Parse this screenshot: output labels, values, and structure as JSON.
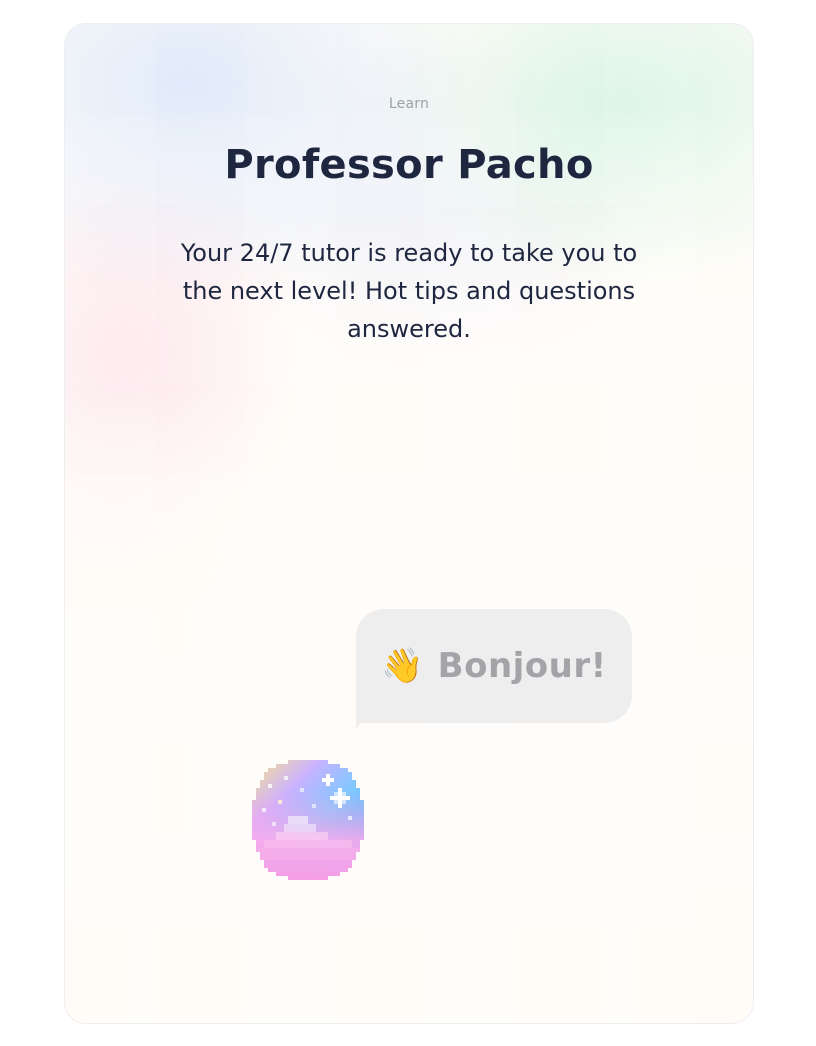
{
  "header": {
    "eyebrow": "Learn",
    "title": "Professor Pacho",
    "description": "Your 24/7 tutor is ready to take you to the next level! Hot tips and questions answered."
  },
  "chat": {
    "greeting_emoji": "👋",
    "greeting_text": "Bonjour!"
  },
  "avatar": {
    "icon": "pixel-orb-avatar"
  },
  "colors": {
    "title": "#1e2640",
    "eyebrow": "#9aa1a8",
    "bubble_bg": "#eeeeee",
    "bubble_text": "#a3a3a8"
  }
}
